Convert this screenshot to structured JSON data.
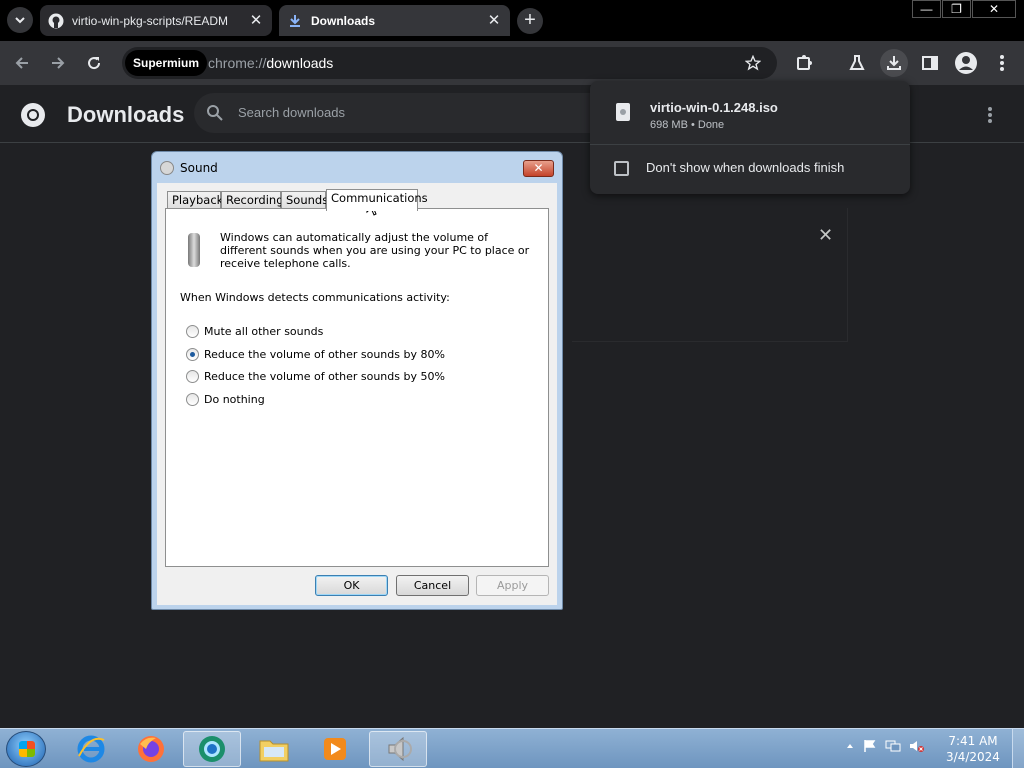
{
  "browser": {
    "tabs": [
      {
        "title": "virtio-win-pkg-scripts/READM",
        "active": false
      },
      {
        "title": "Downloads",
        "active": true
      }
    ],
    "new_tab": "+",
    "window_controls": {
      "minimize": "—",
      "maximize": "❐",
      "close": "✕"
    },
    "omnibox": {
      "chip": "Supermium",
      "scheme": "chrome://",
      "host": "downloads"
    }
  },
  "page": {
    "title": "Downloads",
    "search_placeholder": "Search downloads"
  },
  "bubble": {
    "file_name": "virtio-win-0.1.248.iso",
    "file_meta": "698 MB • Done",
    "checkbox_label": "Don't show when downloads finish",
    "checked": false
  },
  "dialog": {
    "title": "Sound",
    "tabs": [
      "Playback",
      "Recording",
      "Sounds",
      "Communications"
    ],
    "selected_tab": "Communications",
    "intro": "Windows can automatically adjust the volume of different sounds when you are using your PC to place or receive telephone calls.",
    "detects_label": "When Windows detects communications activity:",
    "options": [
      {
        "label": "Mute all other sounds",
        "selected": false
      },
      {
        "label": "Reduce the volume of other sounds by 80%",
        "selected": true
      },
      {
        "label": "Reduce the volume of other sounds by 50%",
        "selected": false
      },
      {
        "label": "Do nothing",
        "selected": false
      }
    ],
    "buttons": {
      "ok": "OK",
      "cancel": "Cancel",
      "apply": "Apply"
    }
  },
  "taskbar": {
    "apps": [
      "internet-explorer",
      "firefox",
      "supermium",
      "file-explorer",
      "media-player",
      "sound"
    ],
    "time": "7:41 AM",
    "date": "3/4/2024"
  },
  "colors": {
    "chrome_bg": "#202124",
    "toolbar": "#35363a",
    "taskbar": "#7fa3c9"
  }
}
